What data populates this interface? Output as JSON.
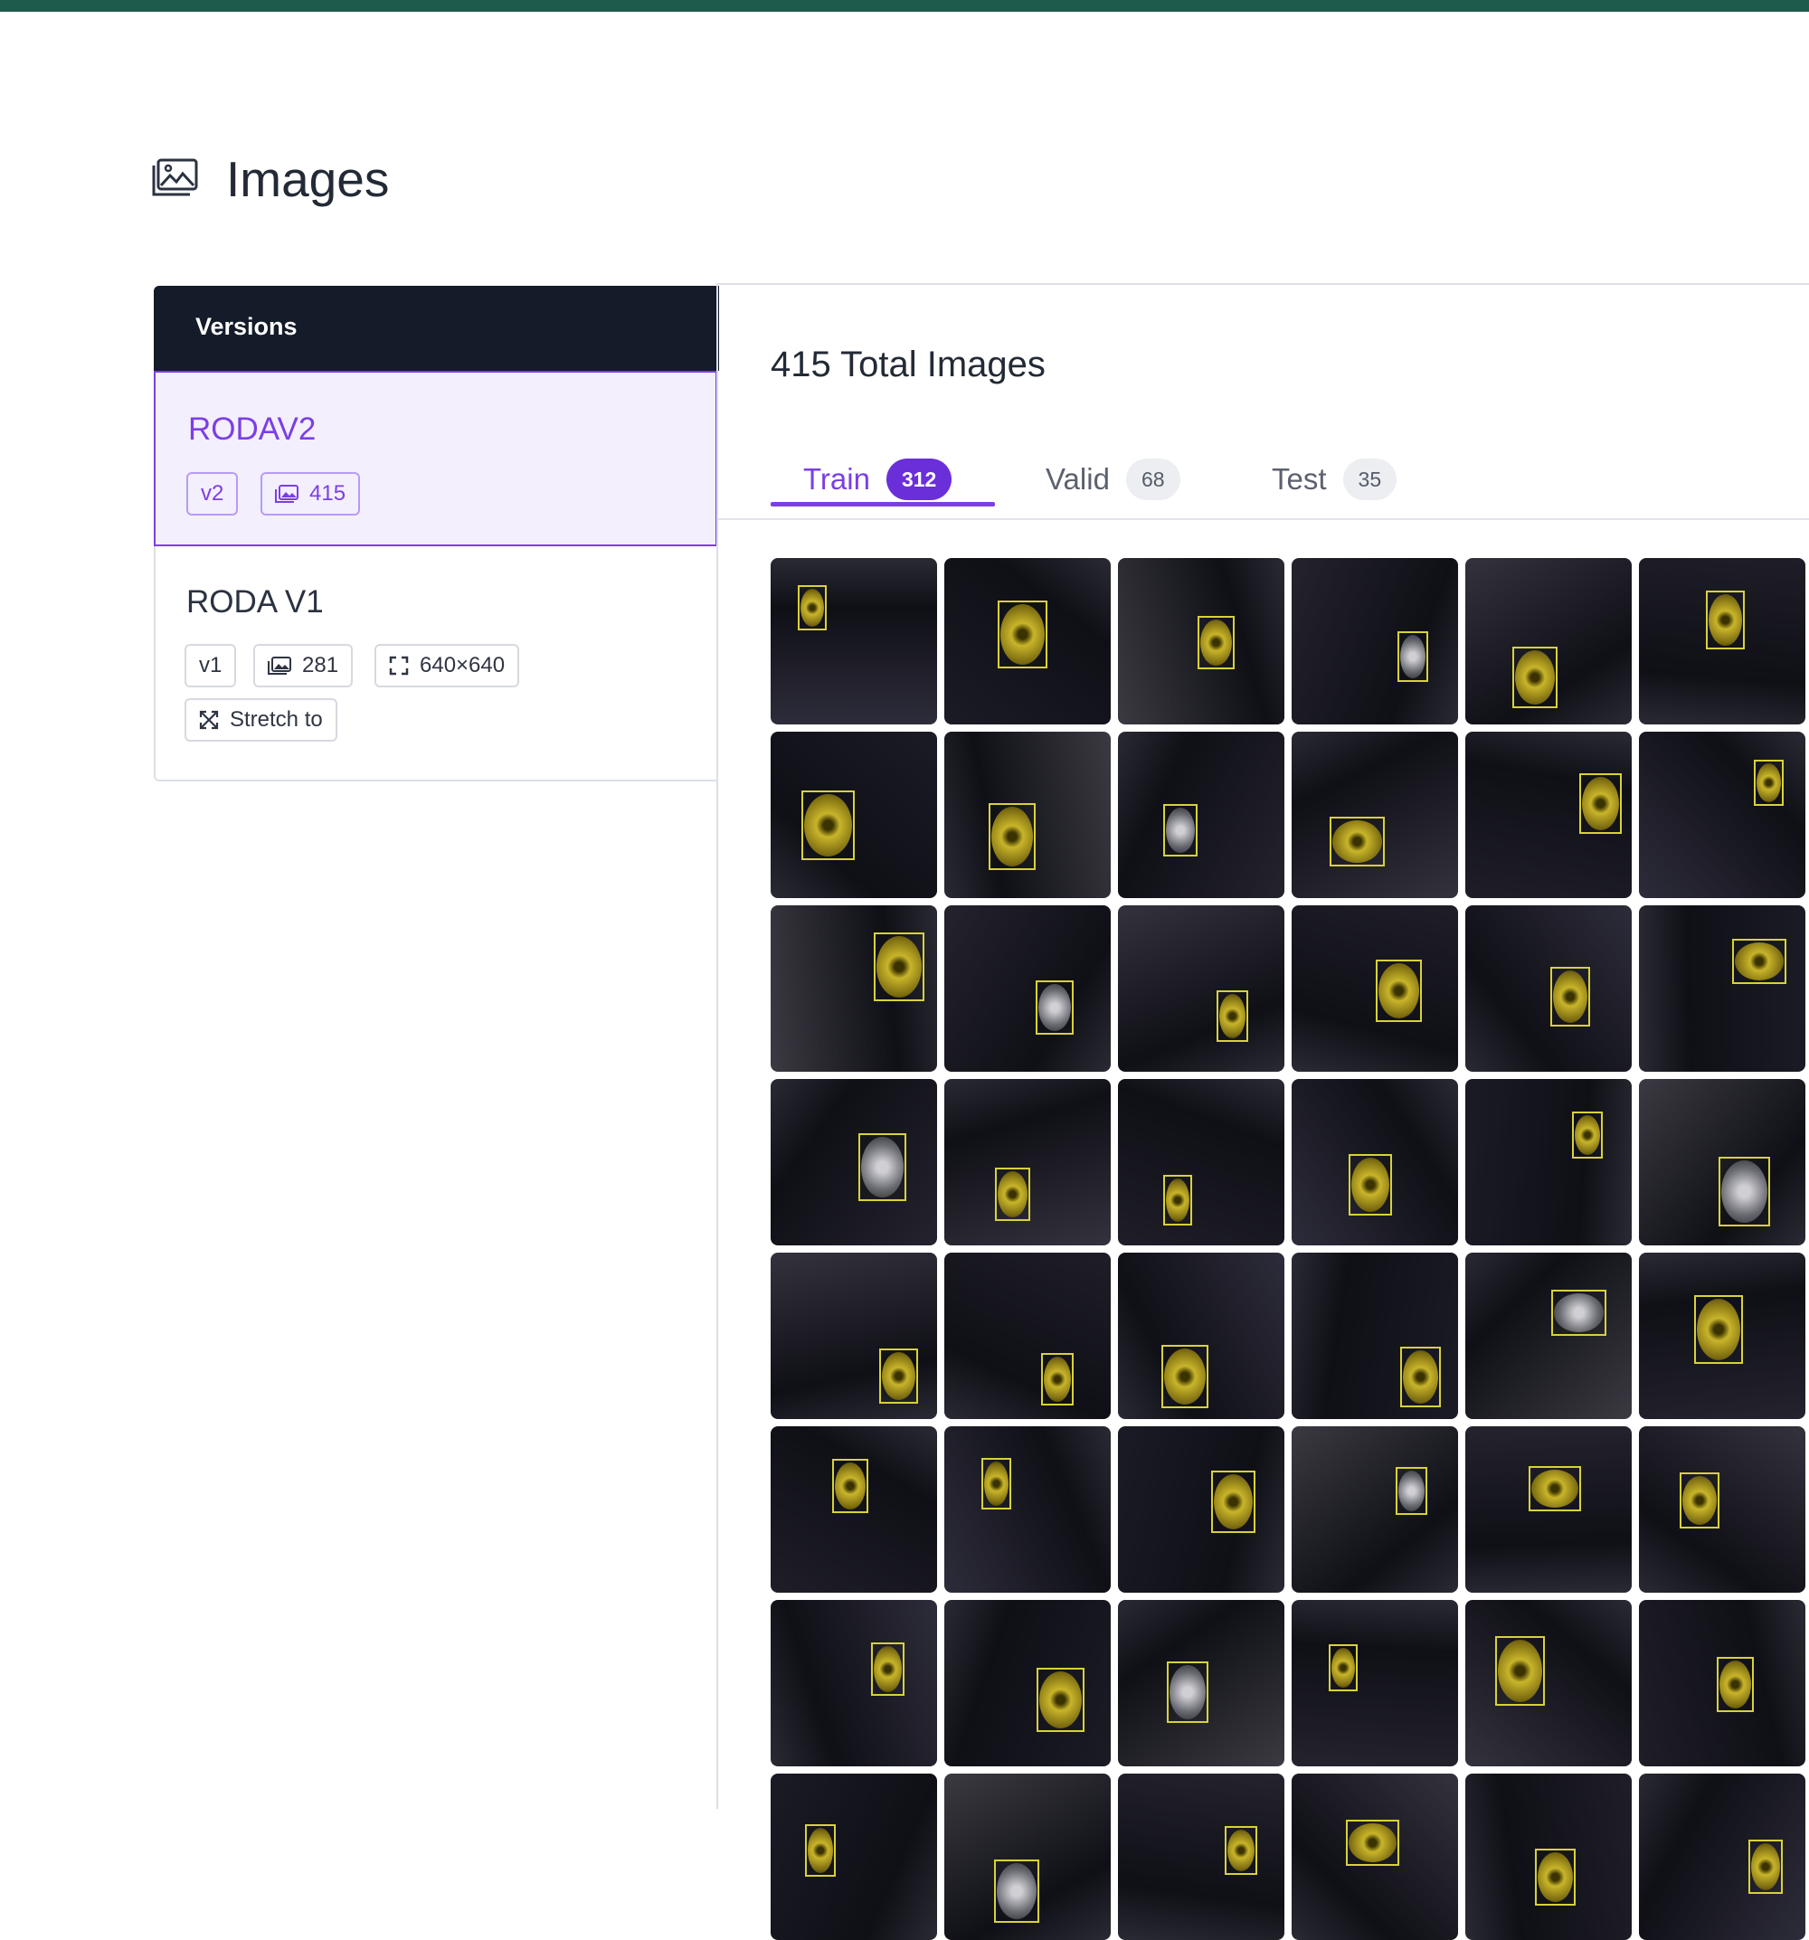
{
  "page": {
    "title": "Images",
    "icon": "images-icon",
    "accent_color": "#7b3fe4",
    "topbar_color": "#1f5b4d"
  },
  "versions": {
    "header": "Versions",
    "items": [
      {
        "name": "RODAV2",
        "selected": true,
        "version_badge": "v2",
        "image_count": "415"
      },
      {
        "name": "RODA V1",
        "selected": false,
        "version_badge": "v1",
        "image_count": "281",
        "resize": "640×640",
        "resize_mode": "Stretch to"
      }
    ]
  },
  "main": {
    "total_label": "415 Total Images",
    "tabs": [
      {
        "label": "Train",
        "count": "312",
        "active": true
      },
      {
        "label": "Valid",
        "count": "68",
        "active": false
      },
      {
        "label": "Test",
        "count": "35",
        "active": false
      }
    ],
    "grid": {
      "description_icon": "annotated-image-thumbnail",
      "thumbnail_count_visible": 48,
      "bbox_color": "#d8d23a"
    }
  }
}
